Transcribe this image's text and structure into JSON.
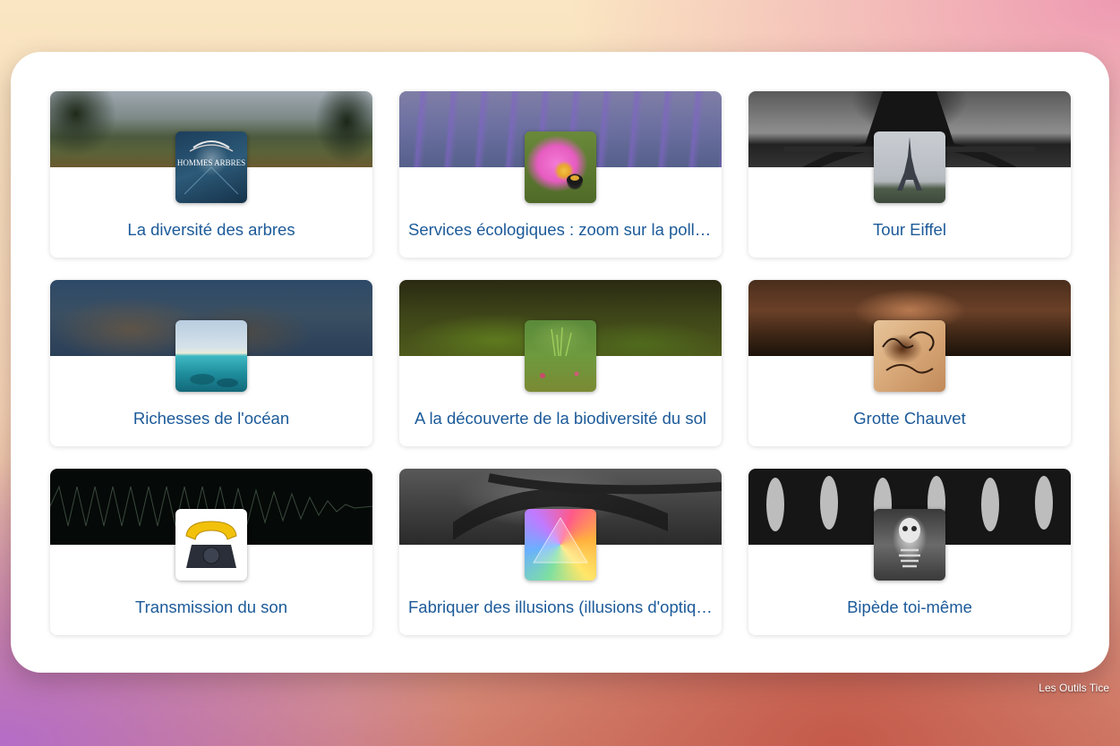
{
  "cards": [
    {
      "title": "La diversité des arbres",
      "thumb_text": "HOMMES ARBRES"
    },
    {
      "title": "Services écologiques : zoom sur la pollinisation"
    },
    {
      "title": "Tour Eiffel"
    },
    {
      "title": "Richesses de l'océan"
    },
    {
      "title": "A la découverte de la biodiversité du sol"
    },
    {
      "title": "Grotte Chauvet"
    },
    {
      "title": "Transmission du son"
    },
    {
      "title": "Fabriquer des illusions (illusions d'optique)"
    },
    {
      "title": "Bipède toi-même"
    }
  ],
  "watermark": "Les Outils Tice",
  "colors": {
    "title_text": "#1c5a99",
    "panel": "#ffffff"
  },
  "icons": [
    "trees-image",
    "flower-bee-image",
    "eiffel-tower-image",
    "ocean-image",
    "moss-image",
    "cave-painting-image",
    "rotary-phone-image",
    "prism-image",
    "skeleton-image"
  ]
}
